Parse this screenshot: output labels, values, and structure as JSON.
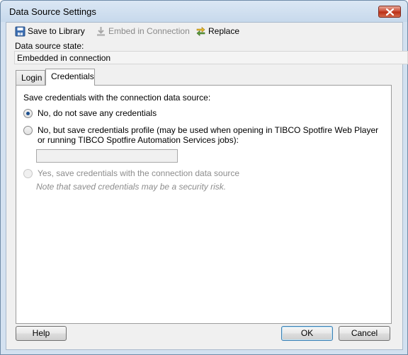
{
  "window": {
    "title": "Data Source Settings"
  },
  "toolbar": {
    "save_to_library": "Save to Library",
    "embed_in_connection": "Embed in Connection",
    "replace": "Replace"
  },
  "data_source": {
    "state_label": "Data source state:",
    "state_value": "Embedded in connection"
  },
  "tabs": [
    {
      "label": "Login",
      "selected": false
    },
    {
      "label": "Credentials",
      "selected": true
    }
  ],
  "credentials": {
    "section_label": "Save credentials with the connection data source:",
    "option_no": "No, do not save any credentials",
    "option_profile_line1": "No, but save credentials profile (may be used when opening in TIBCO Spotfire Web Player",
    "option_profile_line2": "or running TIBCO Spotfire Automation Services jobs):",
    "profile_value": "",
    "option_yes": "Yes, save credentials with the connection data source",
    "note": "Note that saved credentials may be a security risk."
  },
  "buttons": {
    "help": "Help",
    "ok": "OK",
    "cancel": "Cancel"
  },
  "icons": {
    "save_to_library": "save-library-icon",
    "embed_in_connection": "embed-arrow-icon",
    "replace": "replace-arrow-icon",
    "close": "close-icon"
  },
  "colors": {
    "close_button": "#c8452f",
    "selected_radio": "#1c4f8f",
    "disabled_text": "#8d8d8d"
  }
}
